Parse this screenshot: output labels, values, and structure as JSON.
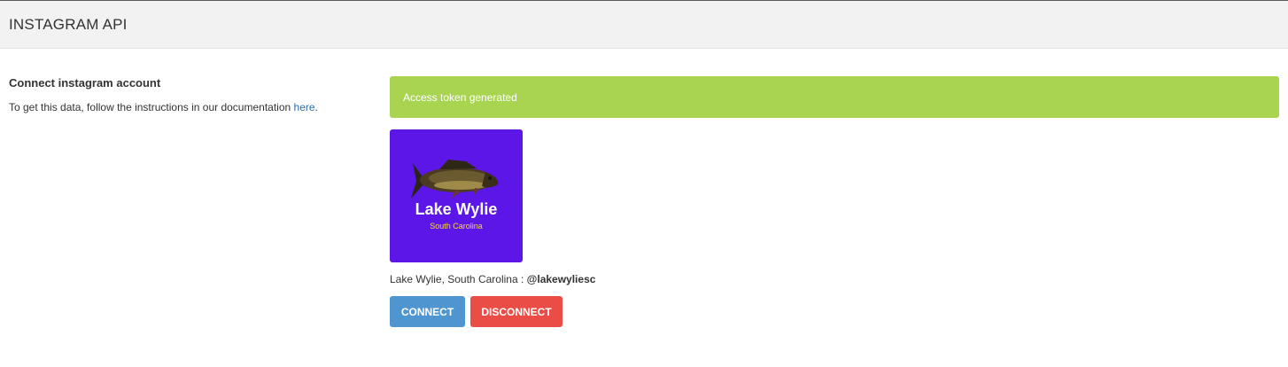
{
  "header": {
    "title": "INSTAGRAM API"
  },
  "settings": {
    "section_title": "Connect instagram account",
    "description_prefix": "To get this data, follow the instructions in our documentation ",
    "doc_link_label": "here",
    "description_suffix": "."
  },
  "alert": {
    "message": "Access token generated",
    "color": "#a9d450"
  },
  "account": {
    "avatar_title": "Lake Wylie",
    "avatar_subtitle": "South Carolina",
    "avatar_background": "#5c16e8",
    "display_name": "Lake Wylie, South Carolina",
    "separator": " : ",
    "handle": "@lakewyliesc"
  },
  "actions": {
    "connect_label": "CONNECT",
    "disconnect_label": "DISCONNECT",
    "connect_color": "#4f95d0",
    "disconnect_color": "#ea4d45"
  }
}
